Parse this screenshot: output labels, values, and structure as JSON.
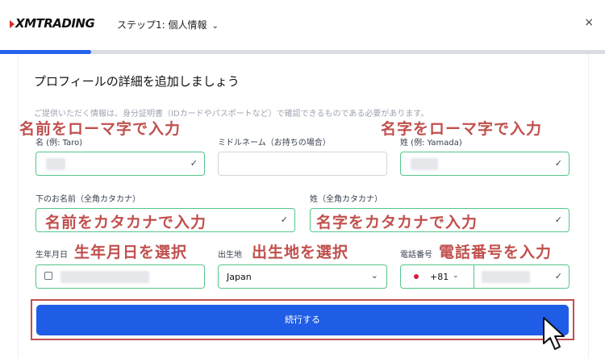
{
  "header": {
    "logo": "XMTRADING",
    "step_label": "ステップ1: 個人情報",
    "close": "×"
  },
  "progress": 0.15,
  "form": {
    "title": "プロフィールの詳細を追加しましょう",
    "notice": "ご提供いただく情報は、身分証明書（IDカードやパスポートなど）で確認できるものである必要があります。",
    "first_name_label": "名 (例: Taro)",
    "middle_name_label": "ミドルネーム（お持ちの場合）",
    "last_name_label": "姓 (例: Yamada)",
    "first_name_kana_label": "下のお名前（全角カタカナ）",
    "last_name_kana_label": "姓（全角カタカナ）",
    "birthdate_label": "生年月日",
    "birthplace_label": "出生地",
    "birthplace_value": "Japan",
    "phone_label": "電話番号",
    "phone_code": "+81",
    "submit_label": "続行する"
  },
  "annotations": {
    "name_romaji": "名前をローマ字で入力",
    "surname_romaji": "名字をローマ字で入力",
    "name_kana": "名前をカタカナで入力",
    "surname_kana": "名字をカタカナで入力",
    "birthdate": "生年月日を選択",
    "birthplace": "出生地を選択",
    "phone": "電話番号を入力"
  },
  "colors": {
    "accent": "#1f5de6",
    "valid_border": "#55c68a",
    "annotation": "#c0504d"
  }
}
